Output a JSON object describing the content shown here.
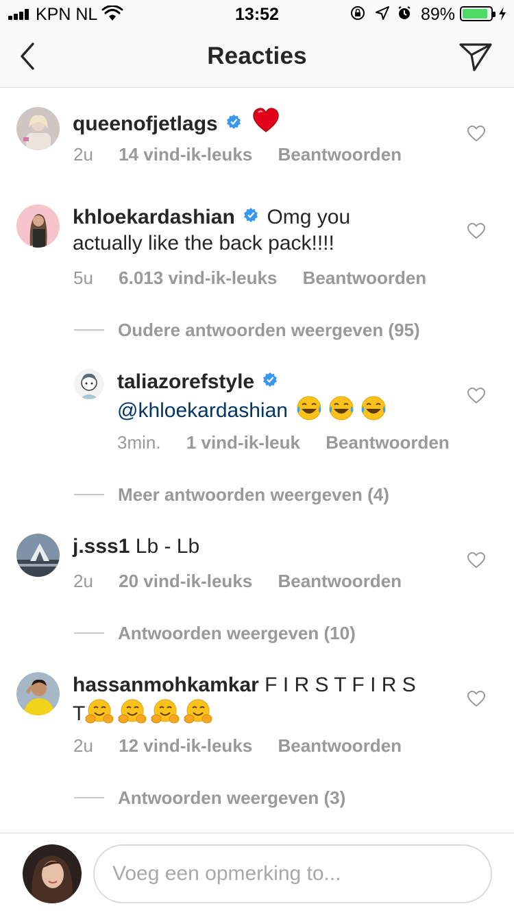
{
  "status_bar": {
    "carrier": "KPN NL",
    "time": "13:52",
    "battery_percent": "89%",
    "battery_level": 0.89,
    "battery_color": "#4cd964"
  },
  "nav": {
    "title": "Reacties",
    "back_icon": "chevron-left-icon",
    "send_icon": "paper-plane-icon"
  },
  "comments": [
    {
      "username": "queenofjetlags",
      "verified": true,
      "text": "",
      "emoji": "❤️",
      "age": "2u",
      "likes": "14 vind-ik-leuks",
      "reply": "Beantwoorden"
    },
    {
      "username": "khloekardashian",
      "verified": true,
      "text": "Omg you",
      "text_line2": "actually like the back pack!!!!",
      "age": "5u",
      "likes": "6.013 vind-ik-leuks",
      "reply": "Beantwoorden",
      "older_replies": "Oudere antwoorden weergeven (95)"
    },
    {
      "username": "taliazorefstyle",
      "verified": true,
      "mention": "@khloekardashian",
      "emoji": "😂 😂 😂",
      "age": "3min.",
      "likes": "1 vind-ik-leuk",
      "reply": "Beantwoorden",
      "more_replies": "Meer antwoorden weergeven (4)"
    },
    {
      "username": "j.sss1",
      "verified": false,
      "text": "Lb - Lb",
      "age": "2u",
      "likes": "20 vind-ik-leuks",
      "reply": "Beantwoorden",
      "view_replies": "Antwoorden weergeven (10)"
    },
    {
      "username": "hassanmohkamkar",
      "verified": false,
      "text": "F I R S T F I R S",
      "text_line2": "T",
      "emoji": "🤗 🤗 🤗 🤗",
      "age": "2u",
      "likes": "12 vind-ik-leuks",
      "reply": "Beantwoorden",
      "view_replies": "Antwoorden weergeven (3)"
    }
  ],
  "composer": {
    "placeholder": "Voeg een opmerking to..."
  }
}
